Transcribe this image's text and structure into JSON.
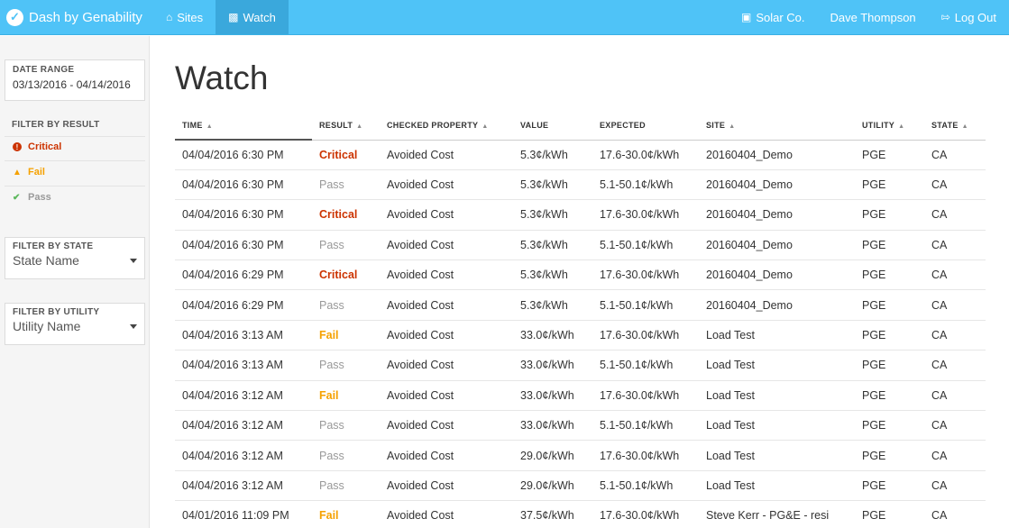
{
  "nav": {
    "brand": "Dash by Genability",
    "items": [
      {
        "label": "Sites",
        "icon": "home-icon"
      },
      {
        "label": "Watch",
        "icon": "binoculars-icon",
        "active": true
      }
    ],
    "right": {
      "company": "Solar Co.",
      "user": "Dave Thompson",
      "logout": "Log Out"
    }
  },
  "sidebar": {
    "date_range": {
      "label": "DATE RANGE",
      "value": "03/13/2016 - 04/14/2016"
    },
    "filter_result": {
      "label": "FILTER BY RESULT",
      "items": [
        {
          "label": "Critical",
          "icon": "exclamation-circle-icon"
        },
        {
          "label": "Fail",
          "icon": "warning-triangle-icon"
        },
        {
          "label": "Pass",
          "icon": "check-icon"
        }
      ]
    },
    "filter_state": {
      "label": "FILTER BY STATE",
      "placeholder": "State Name"
    },
    "filter_utility": {
      "label": "FILTER BY UTILITY",
      "placeholder": "Utility Name"
    }
  },
  "main": {
    "title": "Watch",
    "columns": [
      {
        "label": "TIME",
        "sort": "▲"
      },
      {
        "label": "RESULT",
        "sort": "▲"
      },
      {
        "label": "CHECKED PROPERTY",
        "sort": "▲"
      },
      {
        "label": "VALUE",
        "sort": ""
      },
      {
        "label": "EXPECTED",
        "sort": ""
      },
      {
        "label": "SITE",
        "sort": "▲"
      },
      {
        "label": "UTILITY",
        "sort": "▲"
      },
      {
        "label": "STATE",
        "sort": "▲"
      }
    ],
    "rows": [
      [
        "04/04/2016 6:30 PM",
        "Critical",
        "Avoided Cost",
        "5.3¢/kWh",
        "17.6-30.0¢/kWh",
        "20160404_Demo",
        "PGE",
        "CA"
      ],
      [
        "04/04/2016 6:30 PM",
        "Pass",
        "Avoided Cost",
        "5.3¢/kWh",
        "5.1-50.1¢/kWh",
        "20160404_Demo",
        "PGE",
        "CA"
      ],
      [
        "04/04/2016 6:30 PM",
        "Critical",
        "Avoided Cost",
        "5.3¢/kWh",
        "17.6-30.0¢/kWh",
        "20160404_Demo",
        "PGE",
        "CA"
      ],
      [
        "04/04/2016 6:30 PM",
        "Pass",
        "Avoided Cost",
        "5.3¢/kWh",
        "5.1-50.1¢/kWh",
        "20160404_Demo",
        "PGE",
        "CA"
      ],
      [
        "04/04/2016 6:29 PM",
        "Critical",
        "Avoided Cost",
        "5.3¢/kWh",
        "17.6-30.0¢/kWh",
        "20160404_Demo",
        "PGE",
        "CA"
      ],
      [
        "04/04/2016 6:29 PM",
        "Pass",
        "Avoided Cost",
        "5.3¢/kWh",
        "5.1-50.1¢/kWh",
        "20160404_Demo",
        "PGE",
        "CA"
      ],
      [
        "04/04/2016 3:13 AM",
        "Fail",
        "Avoided Cost",
        "33.0¢/kWh",
        "17.6-30.0¢/kWh",
        "Load Test",
        "PGE",
        "CA"
      ],
      [
        "04/04/2016 3:13 AM",
        "Pass",
        "Avoided Cost",
        "33.0¢/kWh",
        "5.1-50.1¢/kWh",
        "Load Test",
        "PGE",
        "CA"
      ],
      [
        "04/04/2016 3:12 AM",
        "Fail",
        "Avoided Cost",
        "33.0¢/kWh",
        "17.6-30.0¢/kWh",
        "Load Test",
        "PGE",
        "CA"
      ],
      [
        "04/04/2016 3:12 AM",
        "Pass",
        "Avoided Cost",
        "33.0¢/kWh",
        "5.1-50.1¢/kWh",
        "Load Test",
        "PGE",
        "CA"
      ],
      [
        "04/04/2016 3:12 AM",
        "Pass",
        "Avoided Cost",
        "29.0¢/kWh",
        "17.6-30.0¢/kWh",
        "Load Test",
        "PGE",
        "CA"
      ],
      [
        "04/04/2016 3:12 AM",
        "Pass",
        "Avoided Cost",
        "29.0¢/kWh",
        "5.1-50.1¢/kWh",
        "Load Test",
        "PGE",
        "CA"
      ],
      [
        "04/01/2016 11:09 PM",
        "Fail",
        "Avoided Cost",
        "37.5¢/kWh",
        "17.6-30.0¢/kWh",
        "Steve Kerr - PG&E - resi",
        "PGE",
        "CA"
      ]
    ]
  },
  "colors": {
    "nav_bg": "#4fc3f7",
    "nav_active": "#3aa8dc",
    "critical": "#cc3300",
    "fail": "#f5a100",
    "pass": "#999999",
    "pass_check": "#5cb85c"
  }
}
